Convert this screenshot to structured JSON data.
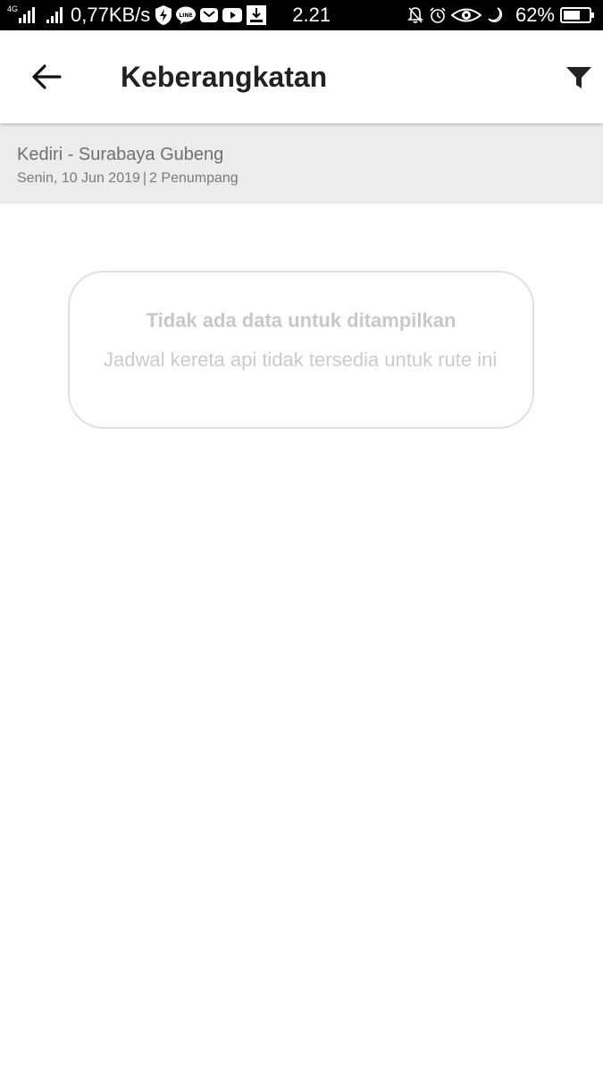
{
  "status_bar": {
    "network_type": "4G",
    "data_speed": "0,77KB/s",
    "time": "2.21",
    "battery": "62%",
    "icons_left": [
      "signal-4g-icon",
      "signal-icon",
      "data-saver-icon",
      "line-app-icon",
      "mail-icon",
      "youtube-icon",
      "download-icon"
    ],
    "icons_right": [
      "bell-muted-icon",
      "alarm-icon",
      "eye-icon",
      "moon-icon",
      "battery-icon"
    ]
  },
  "app_bar": {
    "title": "Keberangkatan",
    "back_icon": "arrow-left-icon",
    "filter_icon": "filter-icon"
  },
  "route": {
    "name": "Kediri - Surabaya Gubeng",
    "date": "Senin, 10 Jun 2019",
    "separator": "|",
    "passengers": "2 Penumpang"
  },
  "empty_state": {
    "title": "Tidak ada data untuk ditampilkan",
    "message": "Jadwal kereta api tidak tersedia untuk rute ini"
  },
  "colors": {
    "status_bar_bg": "#000000",
    "app_bar_bg": "#ffffff",
    "route_bg": "#ececec",
    "empty_text": "#c8c8c8"
  }
}
